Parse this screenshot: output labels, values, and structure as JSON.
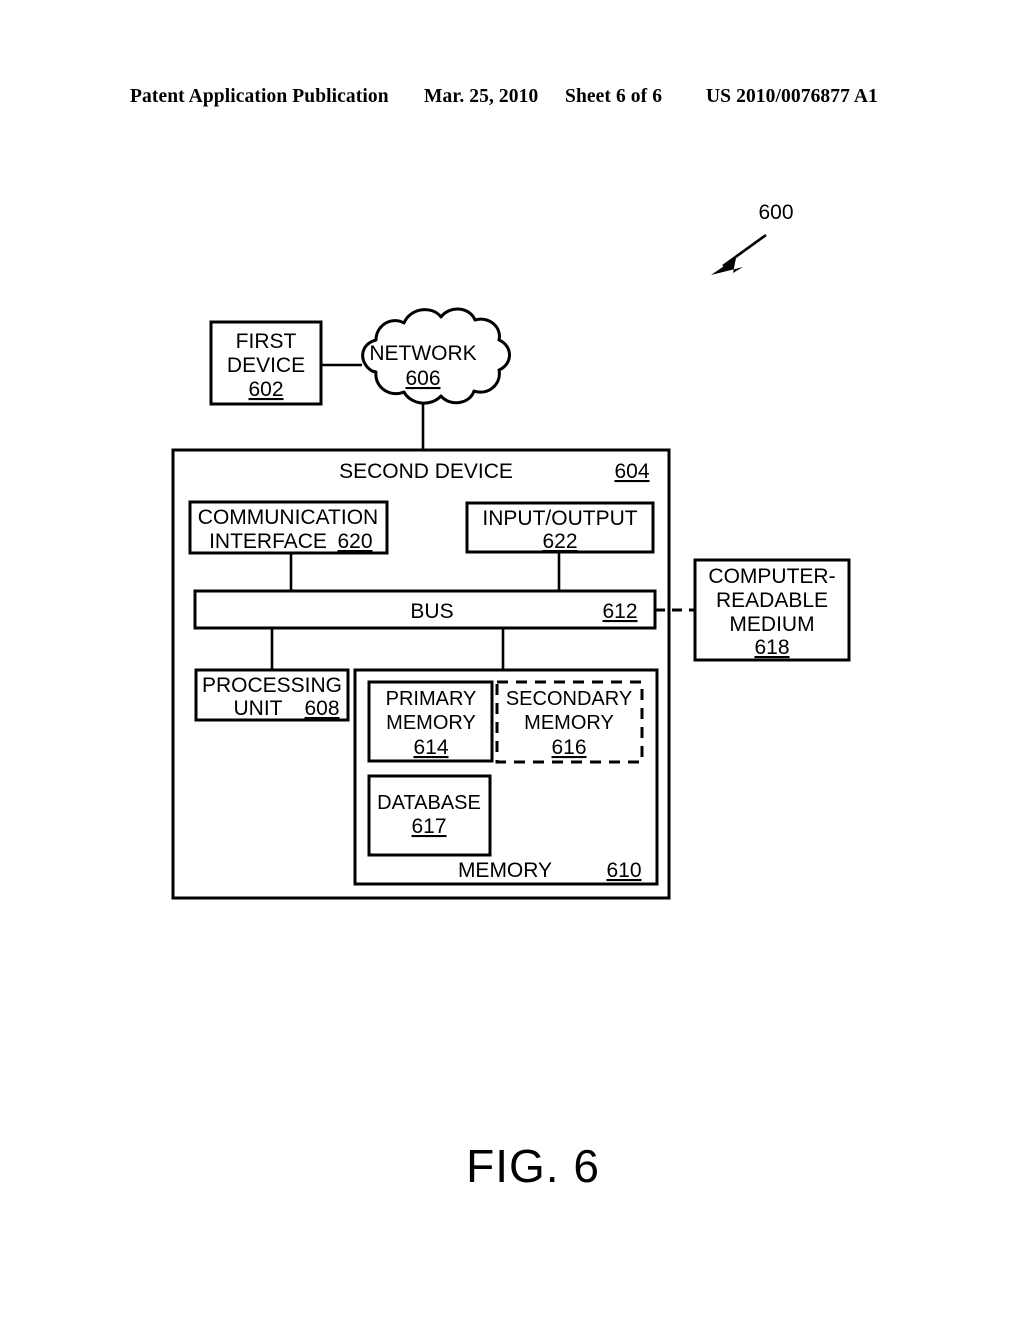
{
  "header": {
    "publication": "Patent Application Publication",
    "date": "Mar. 25, 2010",
    "sheet": "Sheet 6 of 6",
    "document_number": "US 2010/0076877 A1"
  },
  "figure": {
    "caption": "FIG. 6",
    "system_ref": "600",
    "nodes": {
      "first_device": {
        "line1": "FIRST",
        "line2": "DEVICE",
        "ref": "602"
      },
      "network": {
        "label": "NETWORK",
        "ref": "606"
      },
      "second_device": {
        "label": "SECOND DEVICE",
        "ref": "604"
      },
      "communication_interface": {
        "line1": "COMMUNICATION",
        "line2": "INTERFACE",
        "ref": "620"
      },
      "input_output": {
        "label": "INPUT/OUTPUT",
        "ref": "622"
      },
      "bus": {
        "label": "BUS",
        "ref": "612"
      },
      "computer_readable_medium": {
        "line1": "COMPUTER-",
        "line2": "READABLE",
        "line3": "MEDIUM",
        "ref": "618"
      },
      "processing_unit": {
        "line1": "PROCESSING",
        "line2": "UNIT",
        "ref": "608"
      },
      "memory": {
        "label": "MEMORY",
        "ref": "610"
      },
      "primary_memory": {
        "line1": "PRIMARY",
        "line2": "MEMORY",
        "ref": "614"
      },
      "secondary_memory": {
        "line1": "SECONDARY",
        "line2": "MEMORY",
        "ref": "616"
      },
      "database": {
        "label": "DATABASE",
        "ref": "617"
      }
    }
  },
  "colors": {
    "ink": "#000000",
    "paper": "#ffffff"
  }
}
